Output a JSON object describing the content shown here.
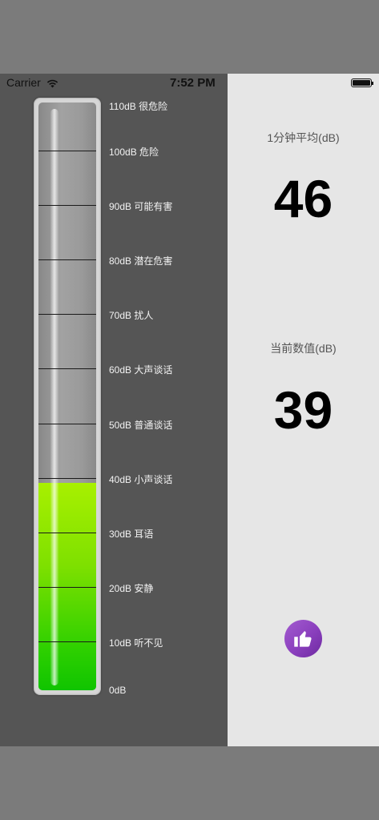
{
  "status_bar": {
    "carrier": "Carrier",
    "time": "7:52 PM"
  },
  "meter": {
    "current_level_db": 39,
    "max_db": 110,
    "fill_color_top": "#a8f000",
    "fill_color_bottom": "#10c400",
    "scale": [
      {
        "label": "110dB 很危险"
      },
      {
        "label": "100dB 危险"
      },
      {
        "label": "90dB 可能有害"
      },
      {
        "label": "80dB 潜在危害"
      },
      {
        "label": "70dB 扰人"
      },
      {
        "label": "60dB 大声谈话"
      },
      {
        "label": "50dB 普通谈话"
      },
      {
        "label": "40dB 小声谈话"
      },
      {
        "label": "30dB 耳语"
      },
      {
        "label": "20dB 安静"
      },
      {
        "label": "10dB 听不见"
      },
      {
        "label": "0dB"
      }
    ]
  },
  "stats": {
    "average_label": "1分钟平均(dB)",
    "average_value": "46",
    "current_label": "当前数值(dB)",
    "current_value": "39"
  },
  "like_button": {
    "icon": "thumbs-up-icon",
    "color": "#8a3fbd"
  }
}
